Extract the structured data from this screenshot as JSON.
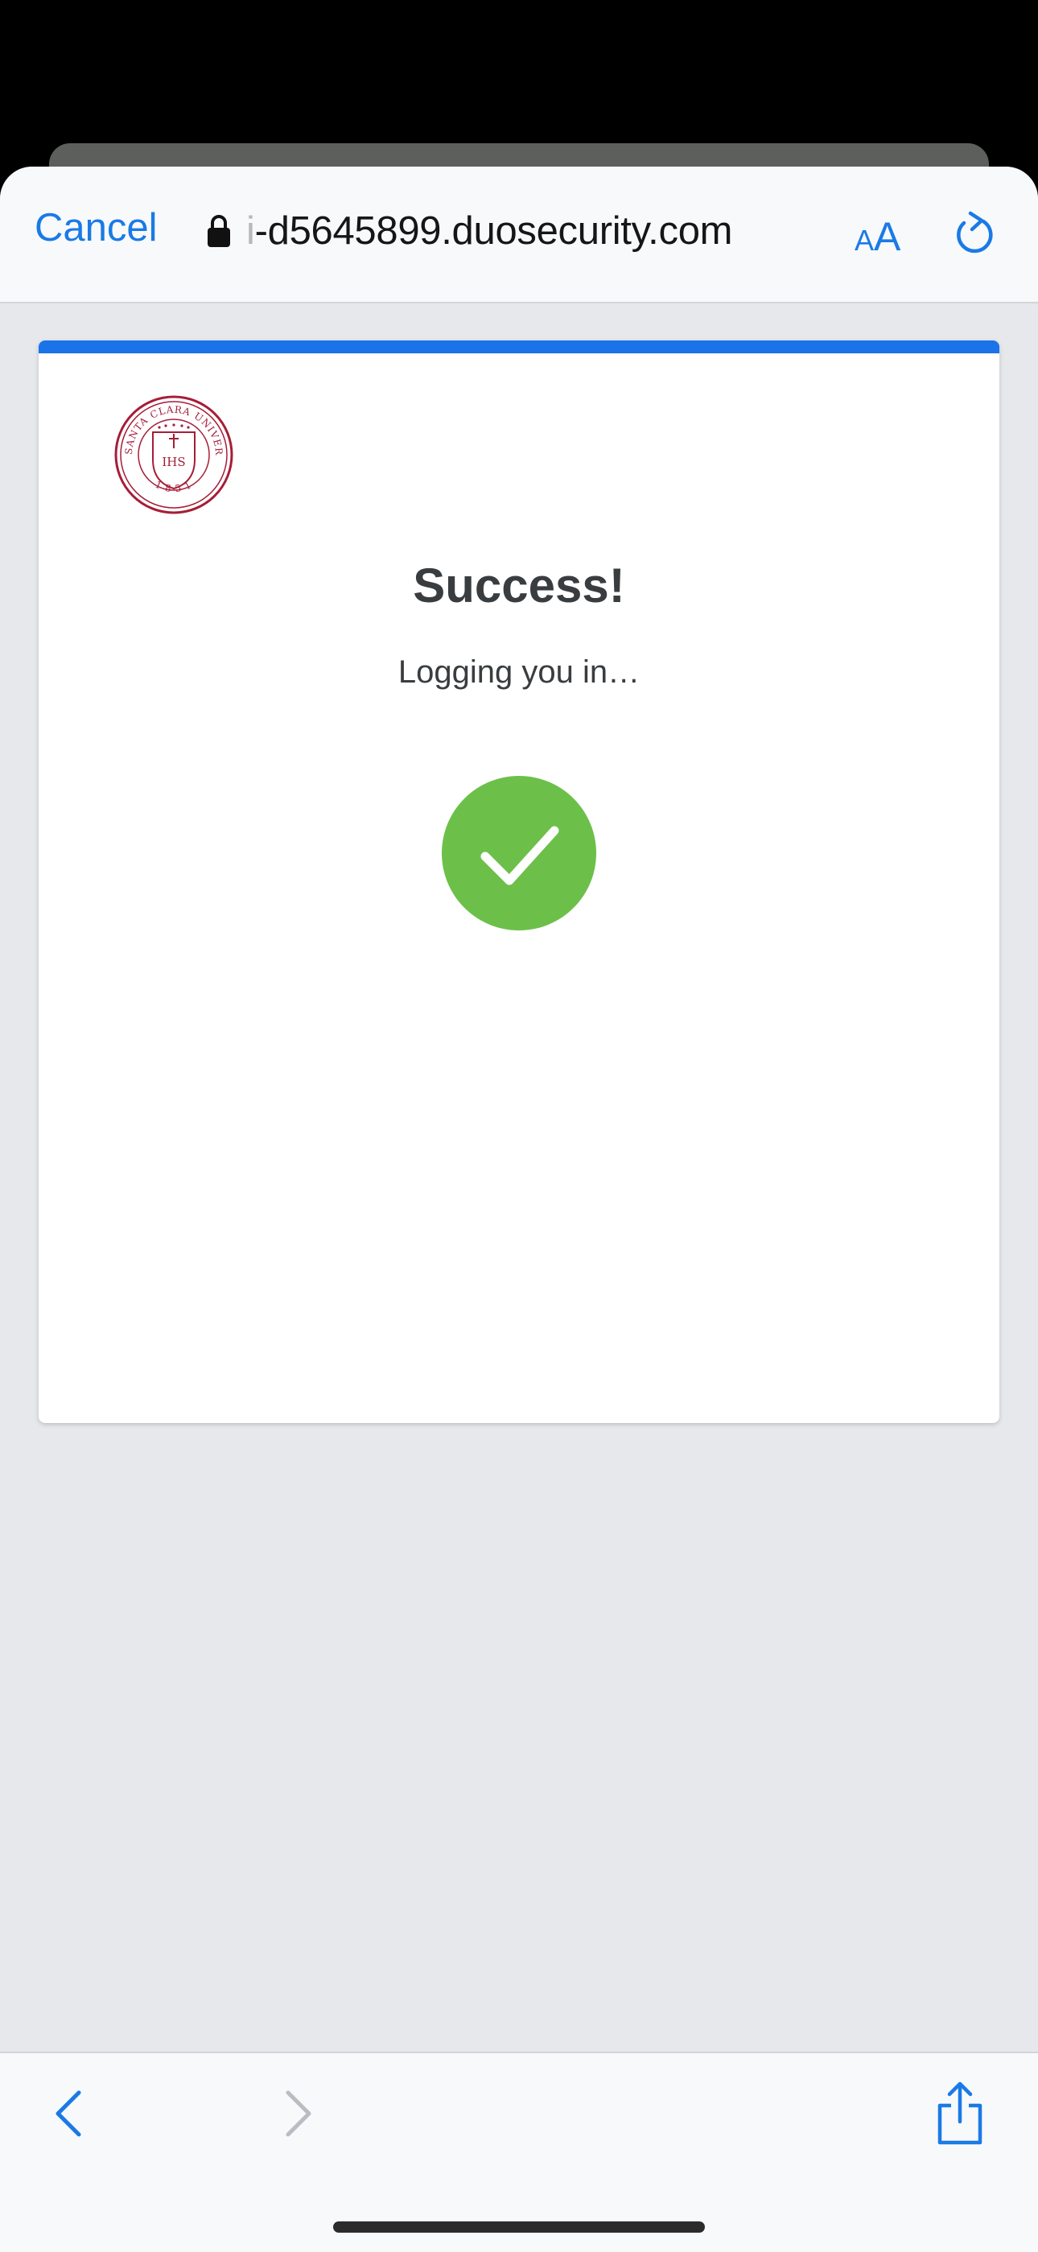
{
  "browser": {
    "cancel_label": "Cancel",
    "url_faded_prefix": "i",
    "url": "-d5645899.duosecurity.com",
    "text_size_small": "A",
    "text_size_large": "A"
  },
  "card": {
    "logo_text": "SANTA CLARA UNIVERSITY",
    "logo_year": "1851",
    "logo_monogram": "IHS",
    "title": "Success!",
    "status": "Logging you in…"
  },
  "colors": {
    "accent": "#1a73e8",
    "ios_blue": "#1a7ae6",
    "success_green": "#6cc04a",
    "seal_red": "#a61d37",
    "page_background": "#e7e8ec"
  },
  "icons": {
    "lock": "lock-icon",
    "reload": "reload-icon",
    "check": "checkmark-icon",
    "back": "chevron-left-icon",
    "forward": "chevron-right-icon",
    "share": "share-icon"
  }
}
